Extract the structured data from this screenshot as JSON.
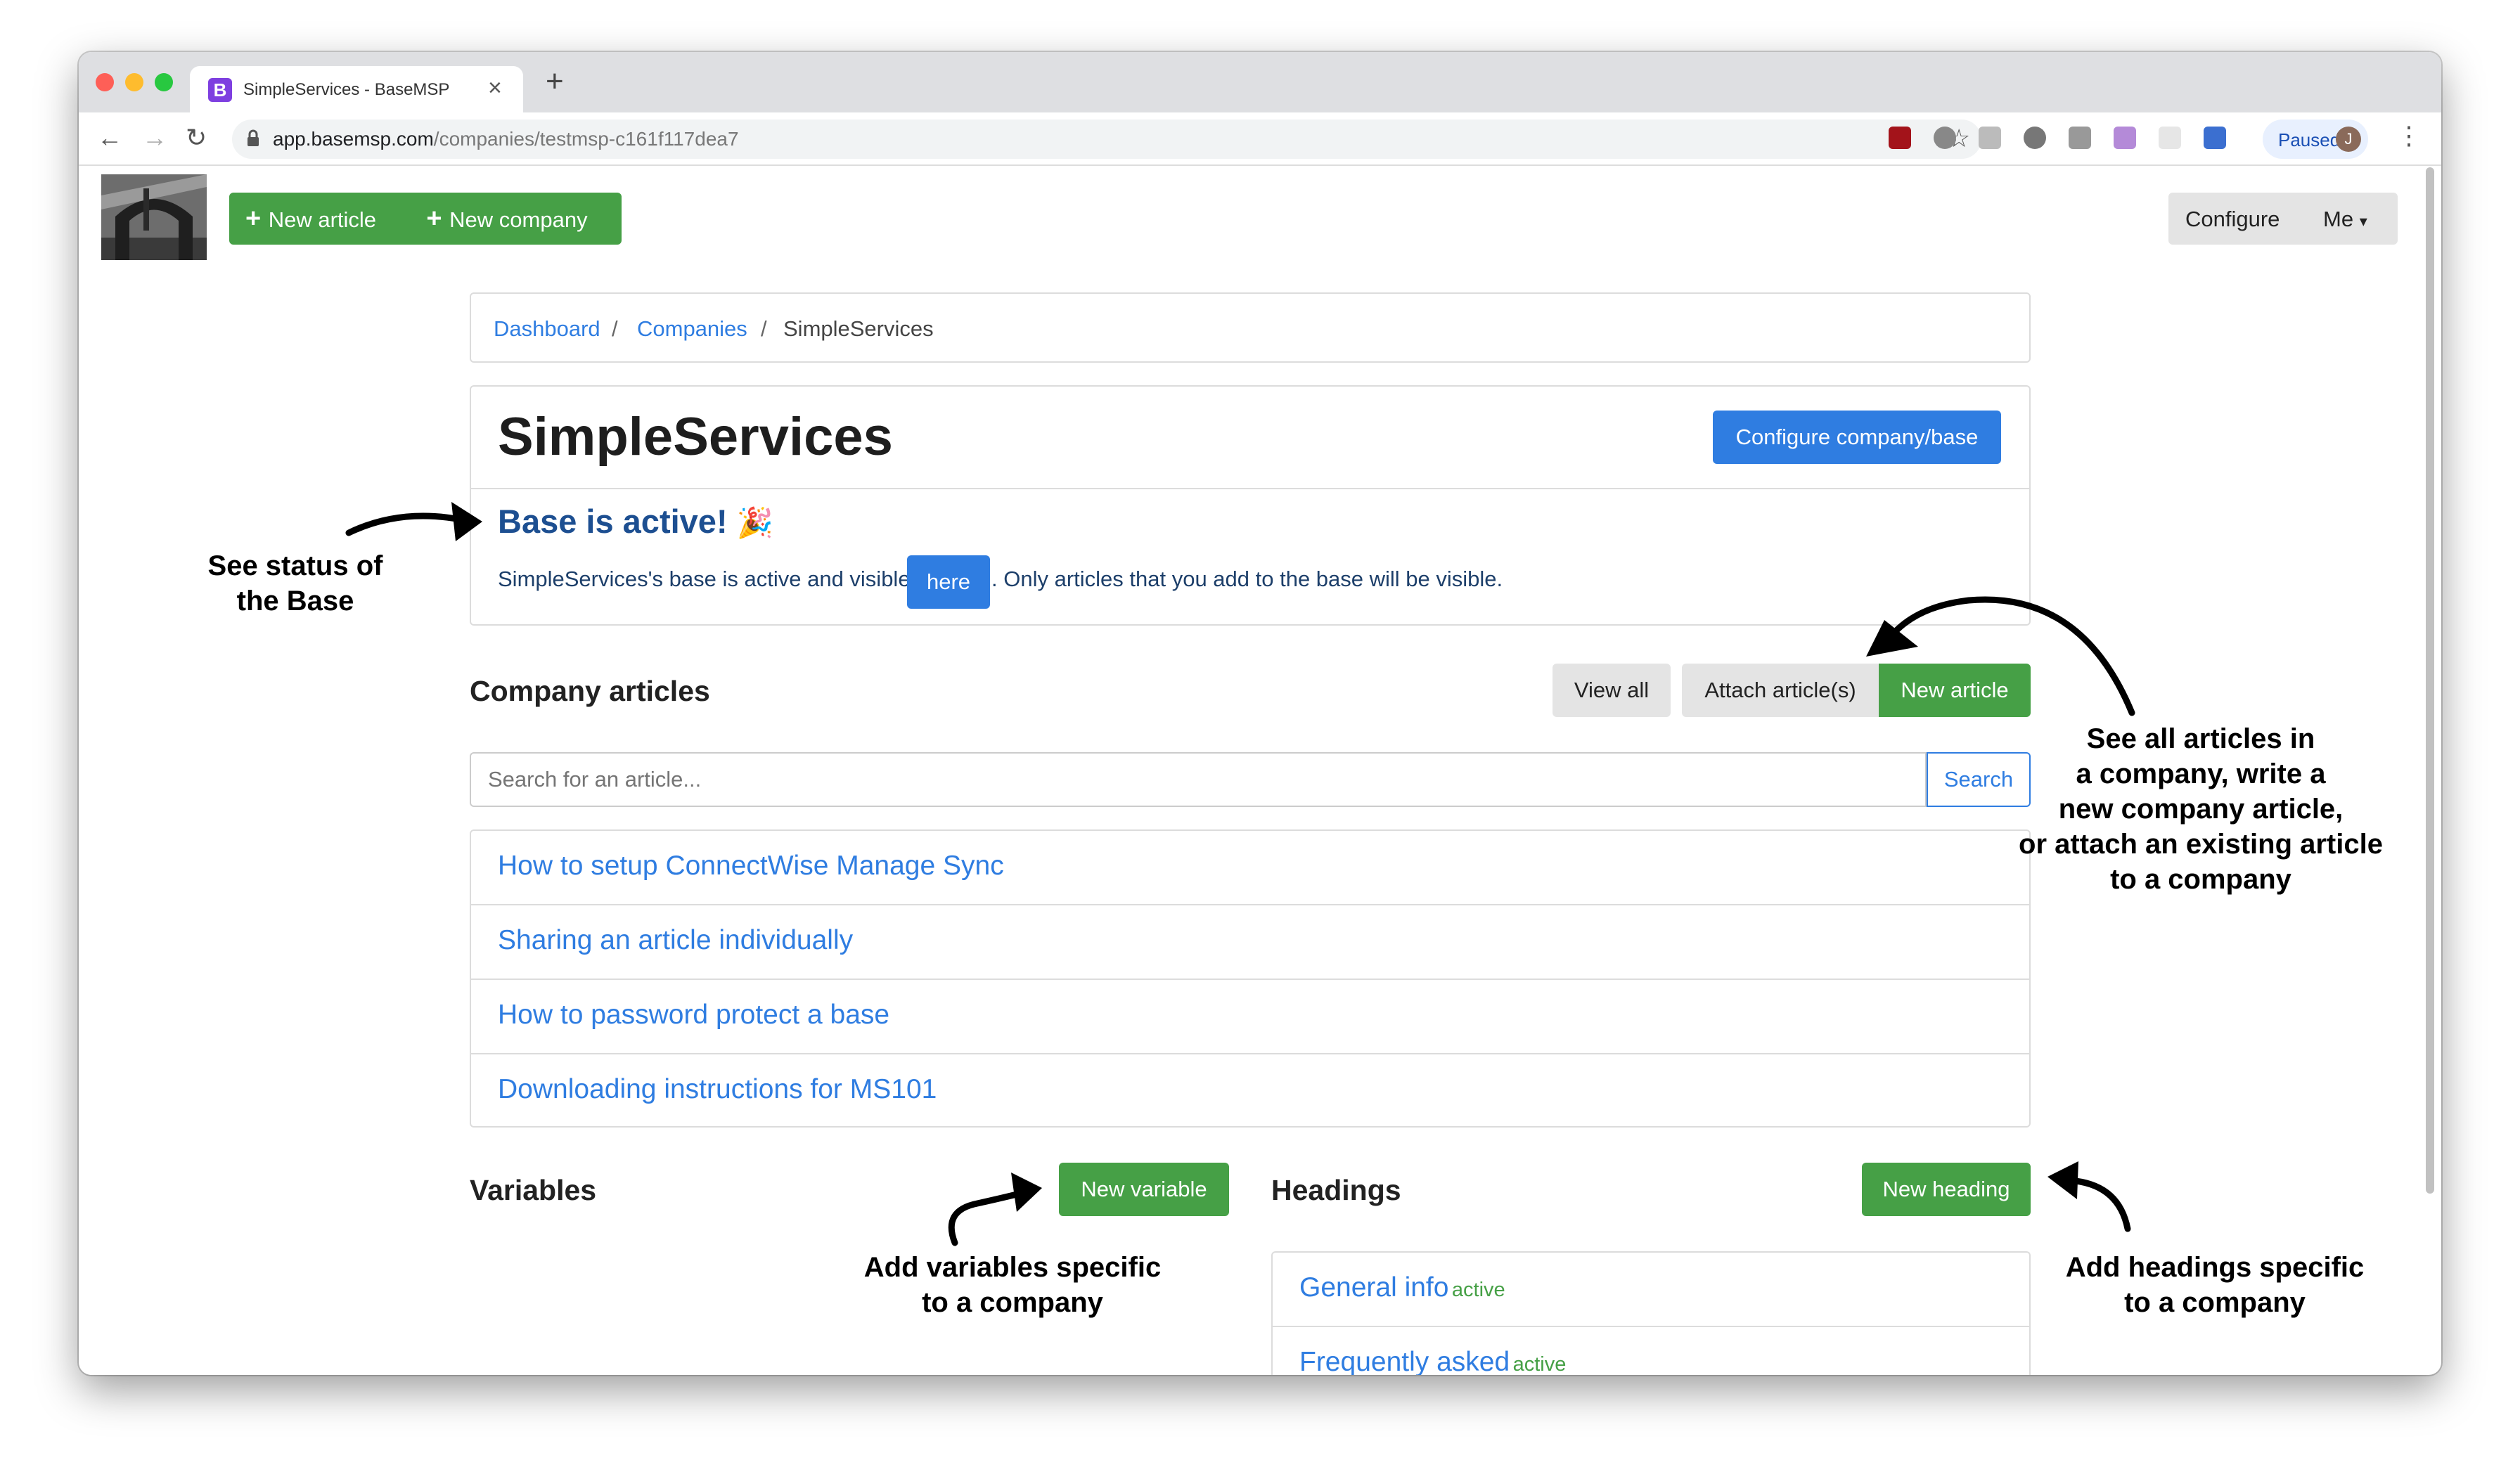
{
  "browser": {
    "tab_title": "SimpleServices - BaseMSP",
    "tab_favicon": "B",
    "url_host": "app.basemsp.com",
    "url_path": "/companies/testmsp-c161f117dea7",
    "profile_status": "Paused",
    "profile_initial": "J"
  },
  "topnav": {
    "new_article": "New article",
    "new_company": "New company",
    "configure": "Configure",
    "me": "Me"
  },
  "breadcrumb": {
    "dashboard": "Dashboard",
    "companies": "Companies",
    "current": "SimpleServices",
    "sep": "/"
  },
  "company": {
    "title": "SimpleServices",
    "configure_button": "Configure company/base",
    "status_title": "Base is active!",
    "status_emoji": "🎉",
    "status_text_before": "SimpleServices's base is active and visible",
    "status_here": "here",
    "status_text_after": ". Only articles that you add to the base will be visible."
  },
  "articles": {
    "heading": "Company articles",
    "view_all": "View all",
    "attach": "Attach article(s)",
    "new_article": "New article",
    "search_placeholder": "Search for an article...",
    "search_button": "Search",
    "items": [
      "How to setup ConnectWise Manage Sync",
      "Sharing an article individually",
      "How to password protect a base",
      "Downloading instructions for MS101"
    ]
  },
  "variables": {
    "heading": "Variables",
    "new_button": "New variable"
  },
  "headings": {
    "heading": "Headings",
    "new_button": "New heading",
    "items": [
      {
        "label": "General info",
        "status": "active"
      },
      {
        "label": "Frequently asked",
        "status": "active"
      }
    ]
  },
  "annotations": {
    "status_line1": "See status of",
    "status_line2": "the Base",
    "articles_line1": "See all articles in",
    "articles_line2": "a company, write a",
    "articles_line3": "new company article,",
    "articles_line4": "or attach an existing article",
    "articles_line5": "to a company",
    "variables_line1": "Add variables specific",
    "variables_line2": "to a company",
    "headings_line1": "Add headings specific",
    "headings_line2": "to a company"
  },
  "colors": {
    "accent_green": "#46a046",
    "accent_blue": "#2f7de1",
    "dark_blue": "#1d4f91"
  }
}
